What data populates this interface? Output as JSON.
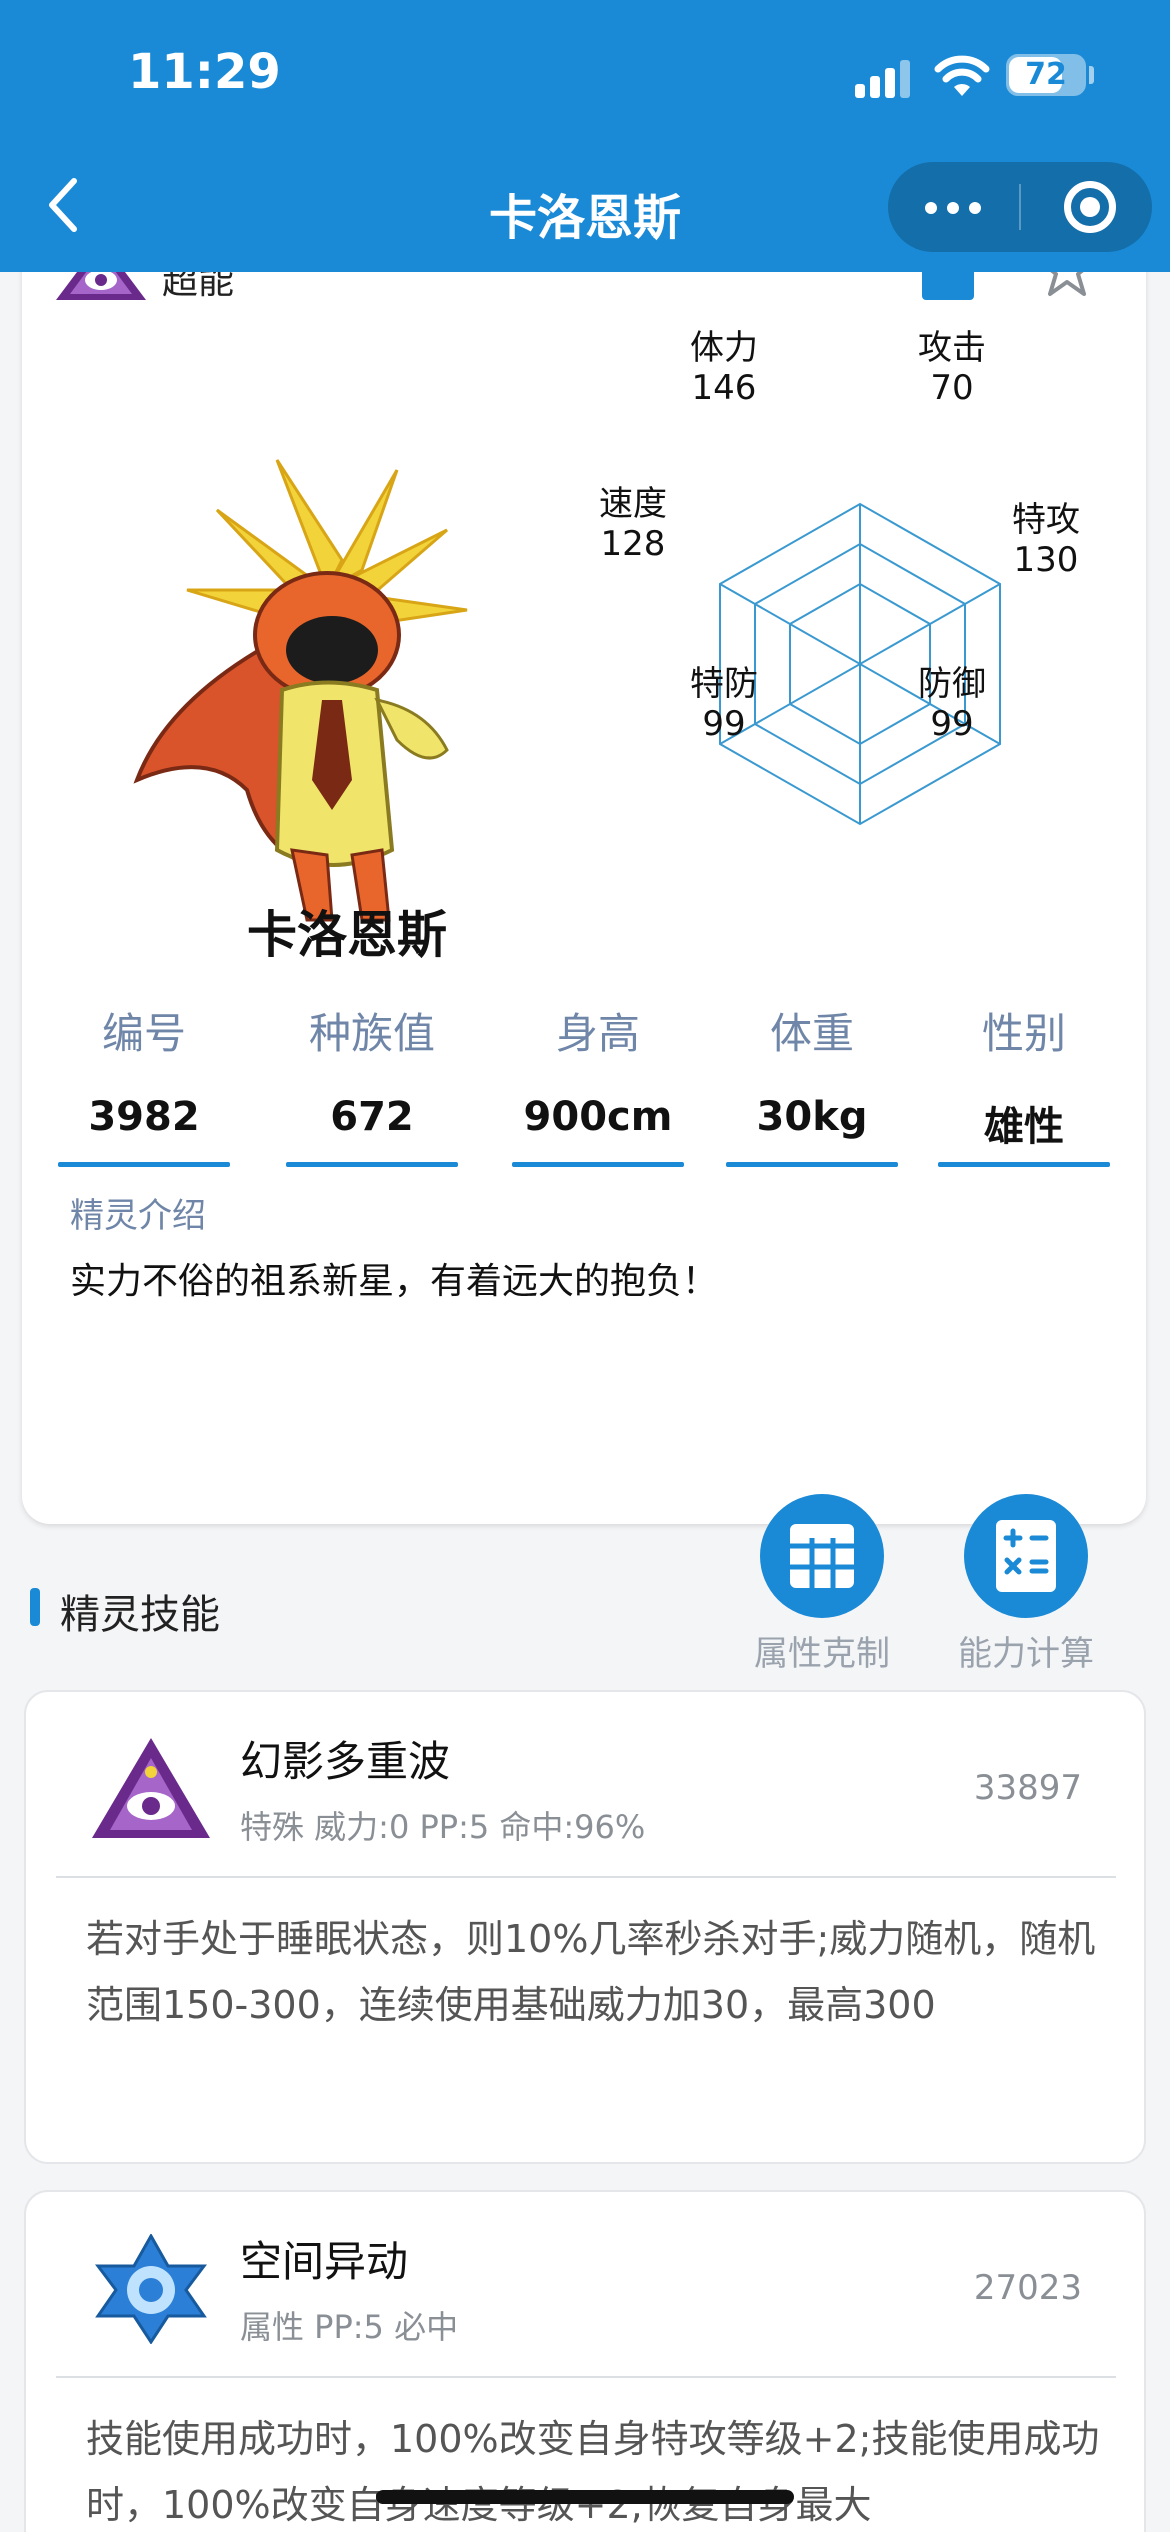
{
  "status_bar": {
    "time": "11:29",
    "battery": "72",
    "battery_level": 0.72
  },
  "nav": {
    "title": "卡洛恩斯"
  },
  "pet": {
    "type_label": "超能",
    "name": "卡洛恩斯",
    "stats": {
      "hp": {
        "label": "体力",
        "value": "146"
      },
      "attack": {
        "label": "攻击",
        "value": "70"
      },
      "sp_attack": {
        "label": "特攻",
        "value": "130"
      },
      "defense": {
        "label": "防御",
        "value": "99"
      },
      "sp_defense": {
        "label": "特防",
        "value": "99"
      },
      "speed": {
        "label": "速度",
        "value": "128"
      }
    },
    "info": [
      {
        "label": "编号",
        "value": "3982"
      },
      {
        "label": "种族值",
        "value": "672"
      },
      {
        "label": "身高",
        "value": "900cm"
      },
      {
        "label": "体重",
        "value": "30kg"
      },
      {
        "label": "性别",
        "value": "雄性"
      }
    ],
    "intro_title": "精灵介绍",
    "intro": "实力不俗的祖系新星，有着远大的抱负！"
  },
  "tools": {
    "type_chart": "属性克制",
    "calculator": "能力计算"
  },
  "skills": {
    "title": "精灵技能",
    "items": [
      {
        "name": "幻影多重波",
        "meta": "特殊 威力:0 PP:5 命中:96%",
        "id": "33897",
        "icon": "psychic-type-icon",
        "desc": "若对手处于睡眠状态，则10%几率秒杀对手;威力随机，随机范围150-300，连续使用基础威力加30，最高300"
      },
      {
        "name": "空间异动",
        "meta": "属性 PP:5 必中",
        "id": "27023",
        "icon": "space-type-icon",
        "desc": "技能使用成功时，100%改变自身特攻等级+2;技能使用成功时，100%改变自身速度等级+2;恢复自身最大"
      }
    ]
  },
  "colors": {
    "primary": "#1a8ad6",
    "label": "#6f86a8",
    "muted": "#8a8f96"
  }
}
